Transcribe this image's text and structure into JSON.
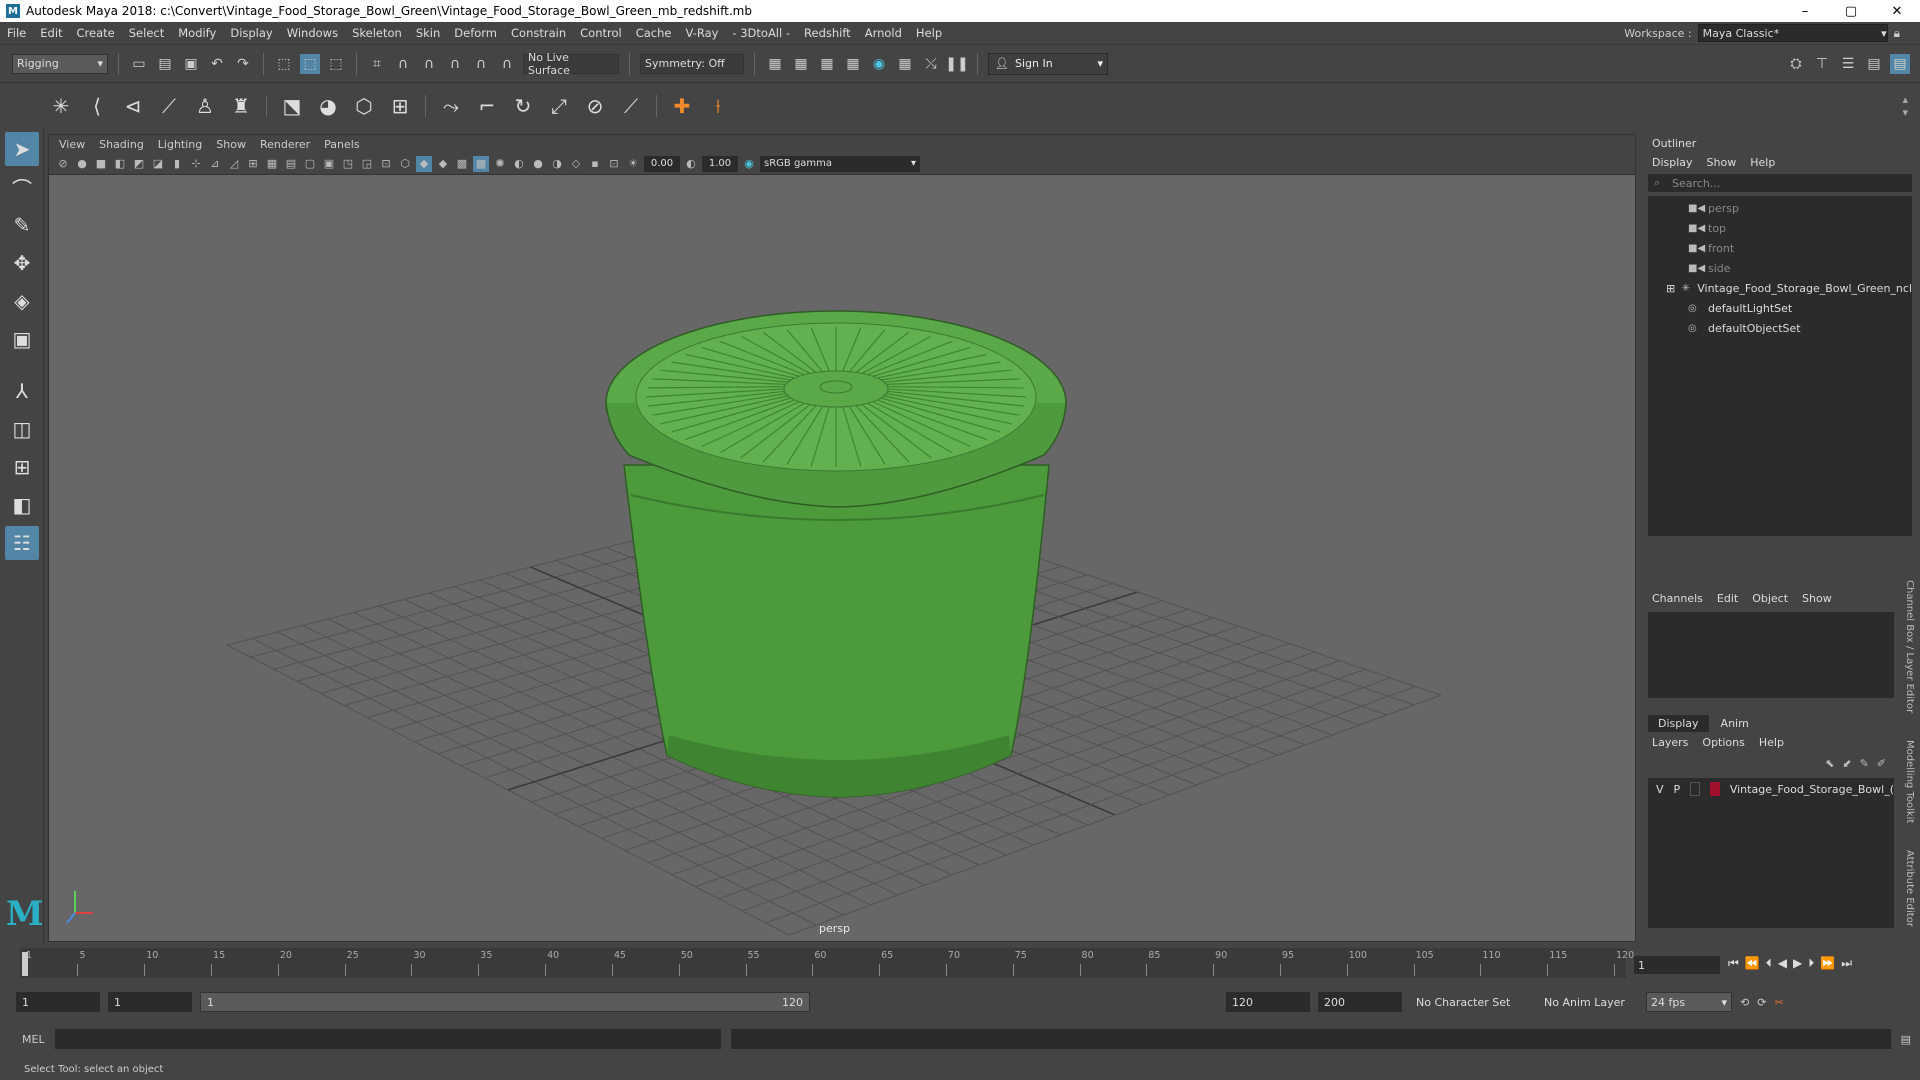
{
  "window": {
    "title": "Autodesk Maya 2018: c:\\Convert\\Vintage_Food_Storage_Bowl_Green\\Vintage_Food_Storage_Bowl_Green_mb_redshift.mb",
    "minimize": "–",
    "maximize": "▢",
    "close": "✕"
  },
  "menubar": {
    "items": [
      "File",
      "Edit",
      "Create",
      "Select",
      "Modify",
      "Display",
      "Windows",
      "Skeleton",
      "Skin",
      "Deform",
      "Constrain",
      "Control",
      "Cache",
      "V-Ray",
      "- 3DtoAll -",
      "Redshift",
      "Arnold",
      "Help"
    ],
    "workspace_label": "Workspace :",
    "workspace_value": "Maya Classic*"
  },
  "statusline": {
    "mode": "Rigging",
    "live_surface": "No Live Surface",
    "symmetry": "Symmetry: Off",
    "sign_in": "Sign In"
  },
  "viewport": {
    "menu": [
      "View",
      "Shading",
      "Lighting",
      "Show",
      "Renderer",
      "Panels"
    ],
    "exposure": "0.00",
    "gamma": "1.00",
    "color_space": "sRGB gamma",
    "camera": "persp"
  },
  "outliner": {
    "title": "Outliner",
    "menu": [
      "Display",
      "Show",
      "Help"
    ],
    "search_placeholder": "Search...",
    "items": [
      {
        "label": "persp",
        "icon": "camera-icon",
        "dim": true
      },
      {
        "label": "top",
        "icon": "camera-icon",
        "dim": true
      },
      {
        "label": "front",
        "icon": "camera-icon",
        "dim": true
      },
      {
        "label": "side",
        "icon": "camera-icon",
        "dim": true
      },
      {
        "label": "Vintage_Food_Storage_Bowl_Green_ncl",
        "icon": "group-icon",
        "dim": false
      },
      {
        "label": "defaultLightSet",
        "icon": "set-icon",
        "dim": false
      },
      {
        "label": "defaultObjectSet",
        "icon": "set-icon",
        "dim": false
      }
    ]
  },
  "channelbox": {
    "menu": [
      "Channels",
      "Edit",
      "Object",
      "Show"
    ]
  },
  "layers": {
    "tabs": [
      "Display",
      "Anim"
    ],
    "menu": [
      "Layers",
      "Options",
      "Help"
    ],
    "layer_v": "V",
    "layer_p": "P",
    "layer_name": "Vintage_Food_Storage_Bowl_(",
    "layer_color": "#a0102c"
  },
  "sidetabs": [
    "Channel Box / Layer Editor",
    "Modelling Toolkit",
    "Attribute Editor"
  ],
  "timeline": {
    "ticks": [
      1,
      5,
      10,
      15,
      20,
      25,
      30,
      35,
      40,
      45,
      50,
      55,
      60,
      65,
      70,
      75,
      80,
      85,
      90,
      95,
      100,
      105,
      110,
      115,
      120
    ],
    "current_frame": "1"
  },
  "range": {
    "start": "1",
    "anim_start": "1",
    "slider_start": "1",
    "slider_end": "120",
    "end": "120",
    "anim_end": "200",
    "character_set": "No Character Set",
    "anim_layer": "No Anim Layer",
    "fps": "24 fps"
  },
  "command": {
    "label": "MEL"
  },
  "help": {
    "text": "Select Tool: select an object"
  },
  "colors": {
    "accent": "#5285a6",
    "object_green": "#4c9a3c",
    "maya_logo": "#2ab0c4"
  }
}
